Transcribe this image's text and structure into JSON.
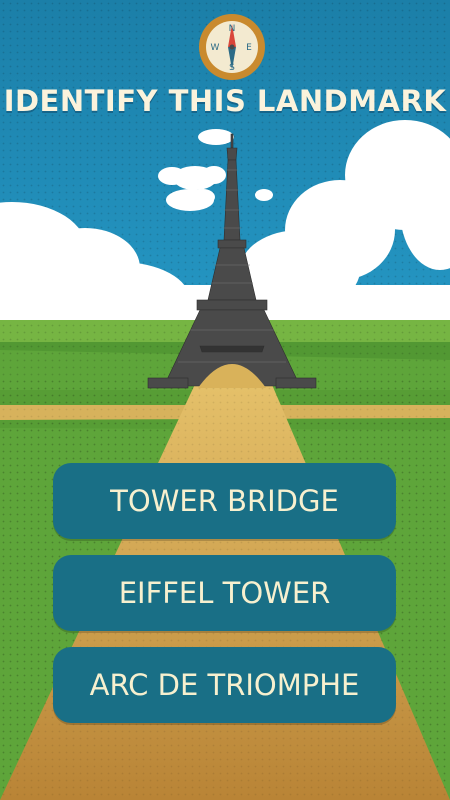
{
  "title": "IDENTIFY THIS LANDMARK",
  "compass": {
    "letters": {
      "n": "N",
      "e": "E",
      "s": "S",
      "w": "W"
    }
  },
  "answers": [
    {
      "label": "TOWER BRIDGE"
    },
    {
      "label": "EIFFEL TOWER"
    },
    {
      "label": "ARC DE TRIOMPHE"
    }
  ],
  "colors": {
    "sky": "#1a86b0",
    "cloud": "#ffffff",
    "grass": "#5ea53a",
    "grass_dark": "#4b8f2e",
    "path": "#d9b25a",
    "tower": "#4a4a4a",
    "button": "#196f86",
    "button_text": "#f7f0cf",
    "compass_ring": "#c98a2e"
  }
}
